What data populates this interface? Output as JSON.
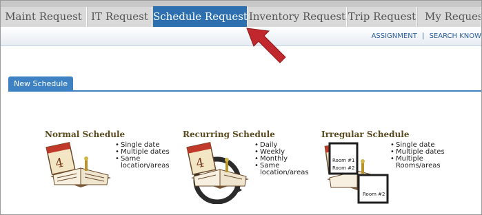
{
  "tabs": [
    {
      "label": "Maint Request",
      "active": false
    },
    {
      "label": "IT Request",
      "active": false
    },
    {
      "label": "Schedule Request",
      "active": true
    },
    {
      "label": "Inventory Request",
      "active": false
    },
    {
      "label": "Trip Request",
      "active": false
    },
    {
      "label": "My Requests",
      "active": false
    }
  ],
  "sublinks": {
    "assignment": "ASSIGNMENT",
    "separator": "|",
    "search": "SEARCH KNOW"
  },
  "section": {
    "tab_label": "New Schedule"
  },
  "schedules": [
    {
      "title": "Normal Schedule",
      "bullets": [
        "Single date",
        "Multiple dates",
        "Same location/areas"
      ]
    },
    {
      "title": "Recurring Schedule",
      "bullets": [
        "Daily",
        "Weekly",
        "Monthly",
        "Same location/areas"
      ]
    },
    {
      "title": "Irregular Schedule",
      "bullets": [
        "Single date",
        "Multiple dates",
        "Multiple Rooms/areas"
      ],
      "room_labels": [
        "Room #1",
        "Room #2",
        "Room #2"
      ]
    }
  ],
  "colors": {
    "active_tab": "#2e6fb0",
    "tab_bar": "#c8c8c8",
    "section_accent": "#3e82c4",
    "arrow": "#c0282d",
    "title_brown": "#5b4a1e"
  }
}
